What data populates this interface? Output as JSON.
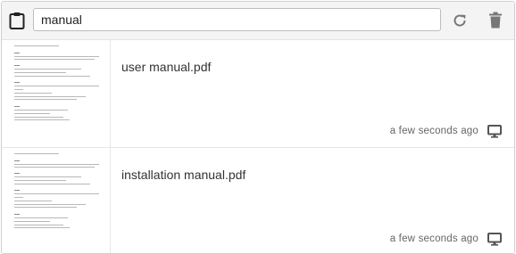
{
  "toolbar": {
    "clipboard_icon": "clipboard-icon",
    "search_value": "manual",
    "refresh_icon": "refresh-icon",
    "delete_icon": "trash-icon"
  },
  "files": [
    {
      "name": "user manual.pdf",
      "time": "a few seconds ago",
      "device_icon": "monitor-icon"
    },
    {
      "name": "installation manual.pdf",
      "time": "a few seconds ago",
      "device_icon": "monitor-icon"
    }
  ],
  "colors": {
    "icon": "#444444",
    "muted_icon": "#777777",
    "toolbar_bg": "#f4f4f4"
  }
}
